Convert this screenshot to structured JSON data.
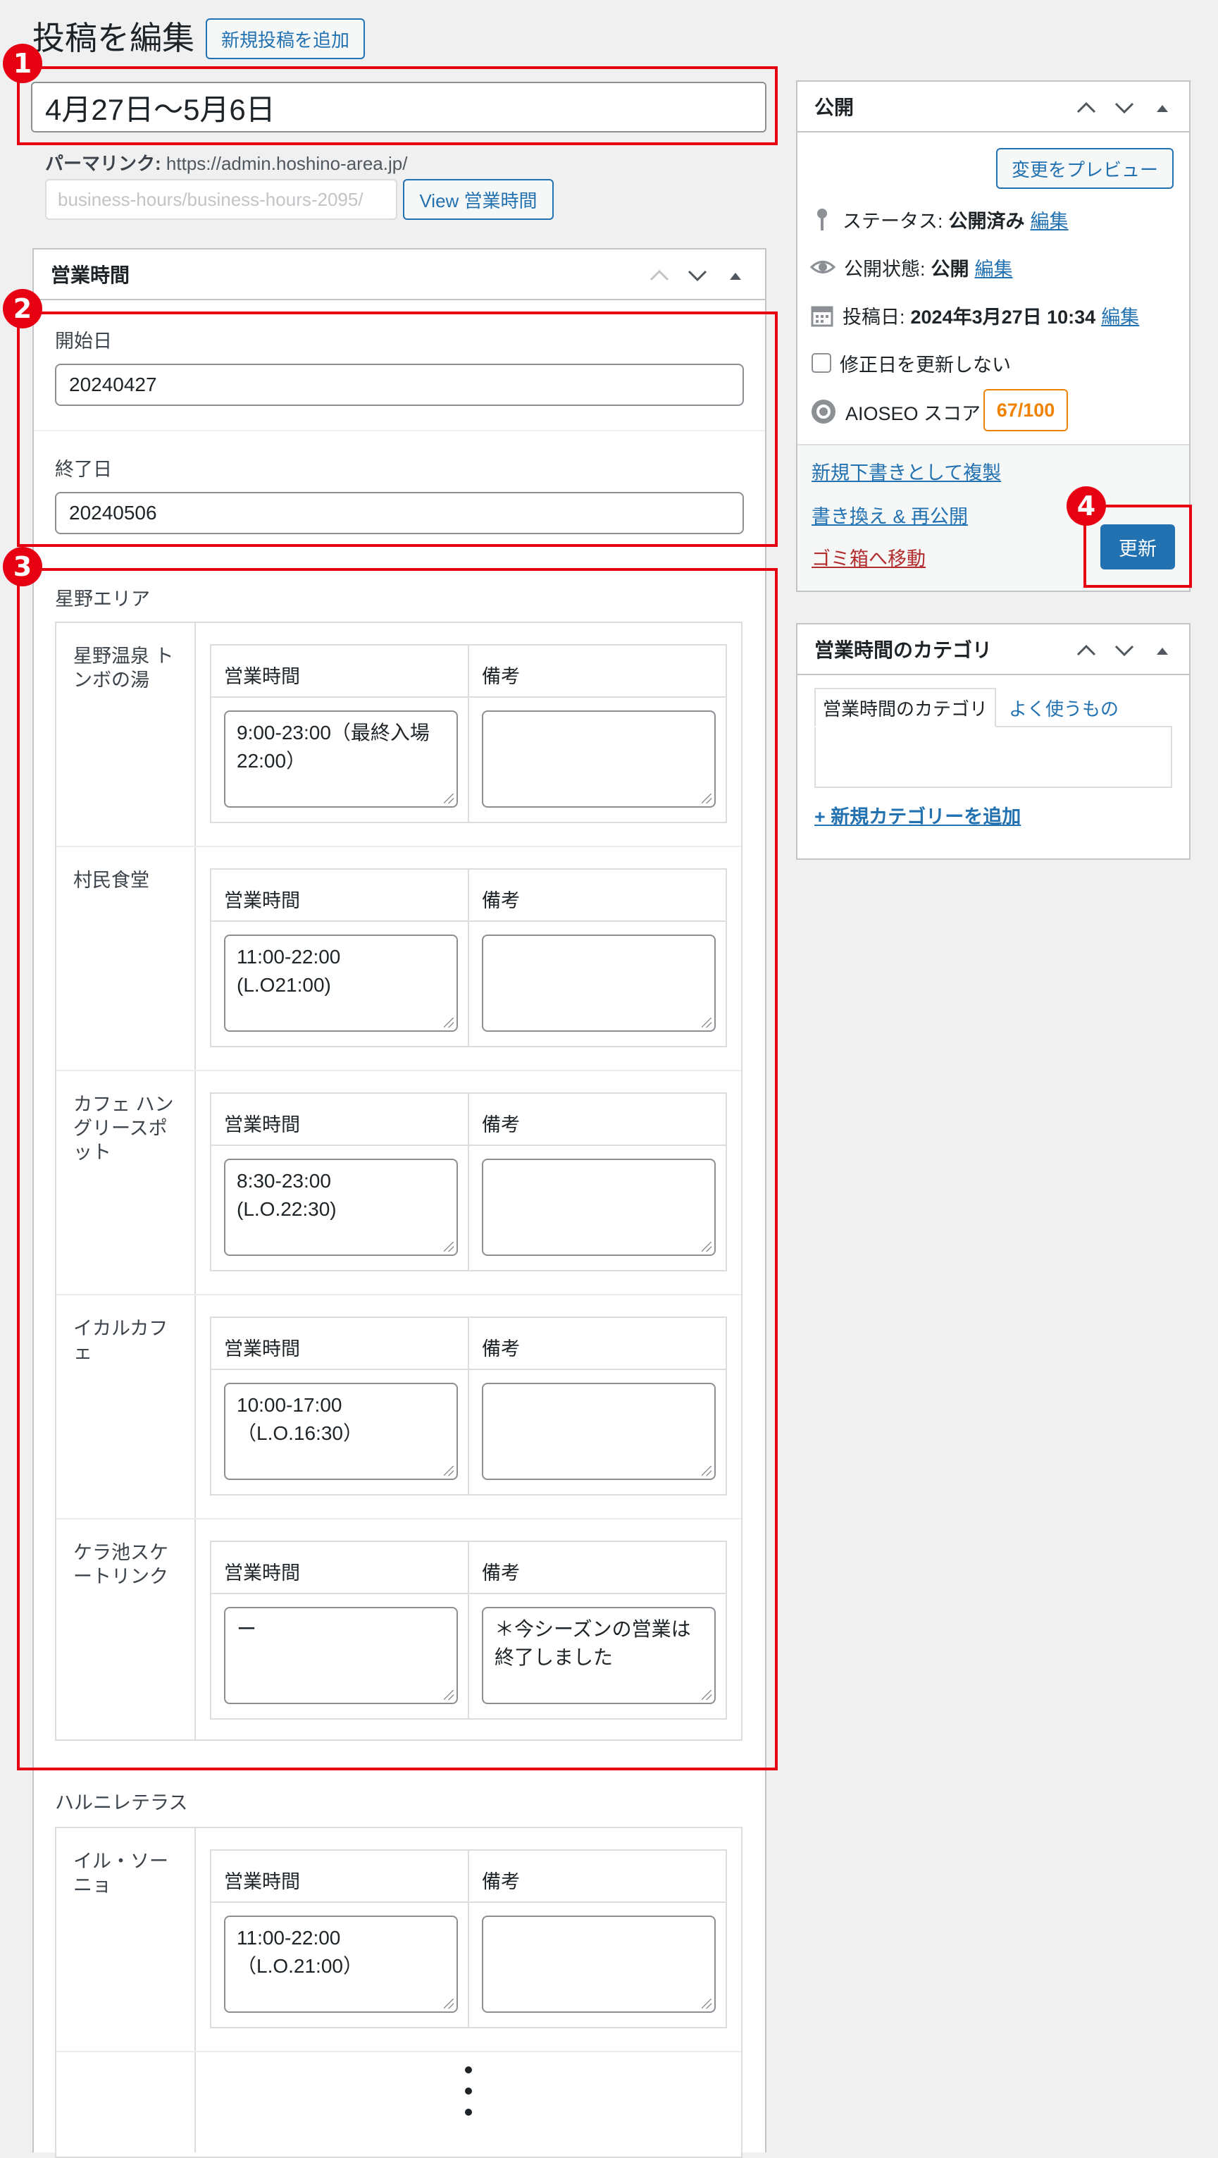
{
  "header": {
    "page_title": "投稿を編集",
    "add_new_label": "新規投稿を追加"
  },
  "post": {
    "title": "4月27日〜5月6日",
    "permalink_label": "パーマリンク:",
    "permalink_base": "https://admin.hoshino-area.jp/",
    "slug": "business-hours/business-hours-2095/",
    "view_button": "View 営業時間"
  },
  "business_hours_box": {
    "title": "営業時間",
    "start_label": "開始日",
    "start_value": "20240427",
    "end_label": "終了日",
    "end_value": "20240506"
  },
  "col_headers": {
    "hours": "営業時間",
    "notes": "備考"
  },
  "areas": [
    {
      "name": "星野エリア",
      "shops": [
        {
          "name": "星野温泉 トンボの湯",
          "hours": "9:00-23:00（最終入場22:00）",
          "notes": ""
        },
        {
          "name": "村民食堂",
          "hours": "11:00-22:00\n(L.O21:00)",
          "notes": ""
        },
        {
          "name": "カフェ ハングリースポット",
          "hours": "8:30-23:00\n(L.O.22:30)",
          "notes": ""
        },
        {
          "name": "イカルカフェ",
          "hours": "10:00-17:00\n（L.O.16:30）",
          "notes": ""
        },
        {
          "name": "ケラ池スケートリンク",
          "hours": "ー",
          "notes": "＊今シーズンの営業は終了しました"
        }
      ]
    },
    {
      "name": "ハルニレテラス",
      "shops": [
        {
          "name": "イル・ソーニョ",
          "hours": "11:00-22:00\n（L.O.21:00）",
          "notes": ""
        }
      ]
    }
  ],
  "publish_box": {
    "title": "公開",
    "preview_button": "変更をプレビュー",
    "status_label": "ステータス:",
    "status_value": "公開済み",
    "visibility_label": "公開状態:",
    "visibility_value": "公開",
    "date_label": "投稿日:",
    "date_value": "2024年3月27日 10:34",
    "edit_link": "編集",
    "no_update_checkbox_label": "修正日を更新しない",
    "aioseo_label": "AIOSEO スコア",
    "aioseo_score": "67/100",
    "duplicate_link": "新規下書きとして複製",
    "rewrite_link": "書き換え & 再公開",
    "trash_link": "ゴミ箱へ移動",
    "update_button": "更新"
  },
  "category_box": {
    "title": "営業時間のカテゴリ",
    "tab_all": "営業時間のカテゴリ",
    "tab_popular": "よく使うもの",
    "add_new_link": "+ 新規カテゴリーを追加"
  },
  "callouts": [
    "1",
    "2",
    "3",
    "4"
  ],
  "colors": {
    "accent": "#2271b1",
    "highlight": "#e60012",
    "aioseo": "#f18200"
  }
}
